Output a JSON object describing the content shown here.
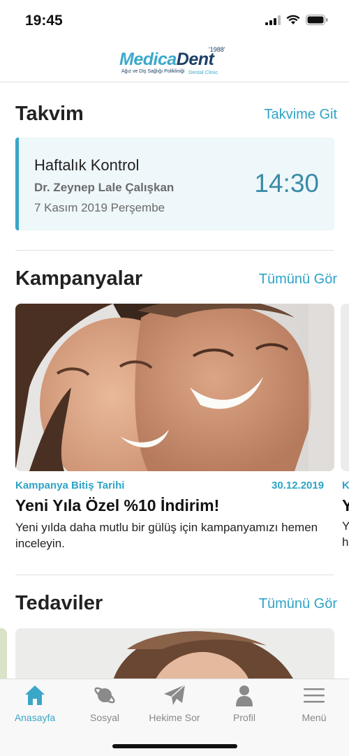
{
  "status_bar": {
    "time": "19:45"
  },
  "header": {
    "logo": {
      "word1": "Medica",
      "word2": "Dent",
      "year": "'1988'",
      "tagline": "Ağız ve Diş Sağlığı Polikliniği",
      "tagline2": "Dental Clinic"
    }
  },
  "calendar": {
    "title": "Takvim",
    "link": "Takvime Git",
    "appointment": {
      "title": "Haftalık Kontrol",
      "doctor": "Dr. Zeynep Lale Çalışkan",
      "date": "7 Kasım 2019 Perşembe",
      "time": "14:30"
    }
  },
  "campaigns": {
    "title": "Kampanyalar",
    "link": "Tümünü Gör",
    "items": [
      {
        "meta_label": "Kampanya Bitiş Tarihi",
        "end_date": "30.12.2019",
        "title": "Yeni Yıla Özel %10 İndirim!",
        "description": "Yeni yılda daha mutlu bir gülüş için kampanyamızı hemen inceleyin."
      }
    ],
    "peek": {
      "meta": "K",
      "title": "Y",
      "desc1": "Y",
      "desc2": "h"
    }
  },
  "treatments": {
    "title": "Tedaviler",
    "link": "Tümünü Gör"
  },
  "tab_bar": {
    "tabs": [
      {
        "label": "Anasayfa",
        "icon": "home-icon",
        "active": true
      },
      {
        "label": "Sosyal",
        "icon": "planet-icon",
        "active": false
      },
      {
        "label": "Hekime Sor",
        "icon": "paper-plane-icon",
        "active": false
      },
      {
        "label": "Profil",
        "icon": "person-icon",
        "active": false
      },
      {
        "label": "Menü",
        "icon": "menu-icon",
        "active": false
      }
    ]
  },
  "colors": {
    "accent": "#3aa6c8",
    "brand_dark": "#1c3f66",
    "card_bg": "#eef7fa",
    "time_color": "#3a8ba6"
  }
}
